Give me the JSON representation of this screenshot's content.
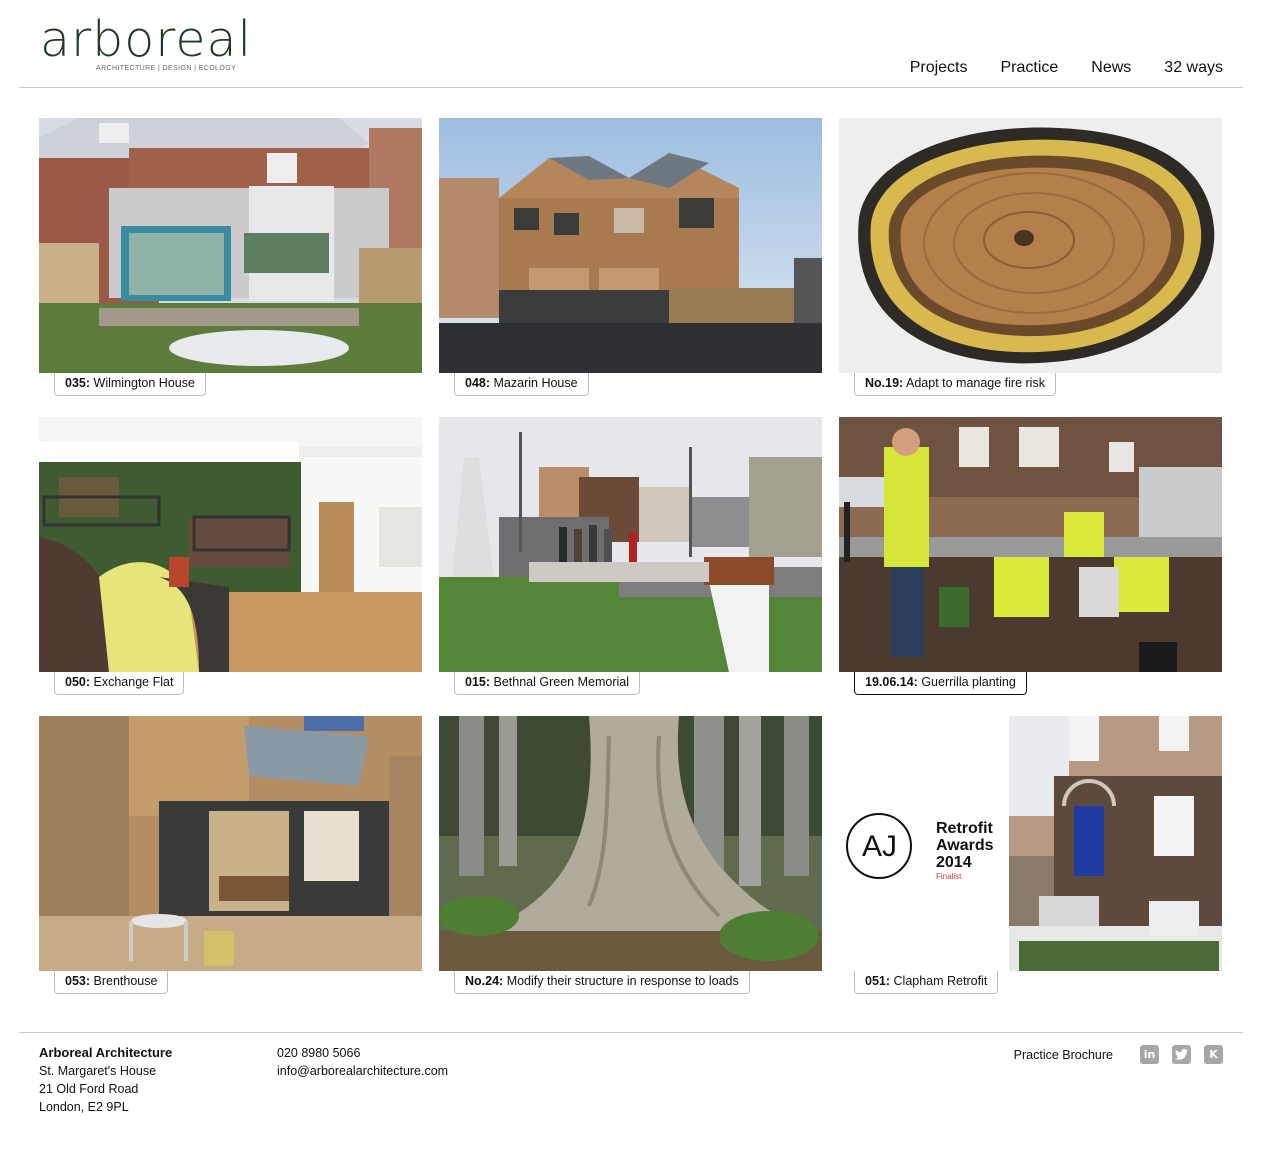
{
  "header": {
    "logo_text": "arboreal",
    "logo_tagline": "ARCHITECTURE | DESIGN | ECOLOGY",
    "nav": [
      "Projects",
      "Practice",
      "News",
      "32 ways"
    ]
  },
  "projects": [
    {
      "num": "035:",
      "title": "Wilmington House"
    },
    {
      "num": "048:",
      "title": "Mazarin House"
    },
    {
      "num": "No.19:",
      "title": "Adapt to manage fire risk"
    },
    {
      "num": "050:",
      "title": "Exchange Flat"
    },
    {
      "num": "015:",
      "title": "Bethnal Green Memorial"
    },
    {
      "num": "19.06.14:",
      "title": "Guerrilla planting"
    },
    {
      "num": "053:",
      "title": "Brenthouse"
    },
    {
      "num": "No.24:",
      "title": "Modify their structure in response to loads"
    },
    {
      "num": "051:",
      "title": "Clapham Retrofit"
    }
  ],
  "award": {
    "logo": "AJ",
    "line1": "Retrofit",
    "line2": "Awards",
    "line3": "2014",
    "status": "Finalist"
  },
  "footer": {
    "company": "Arboreal Architecture",
    "address1": "St. Margaret's House",
    "address2": "21 Old Ford Road",
    "address3": "London, E2 9PL",
    "phone": "020 8980 5066",
    "email": "info@arborealarchitecture.com",
    "brochure": "Practice Brochure",
    "social": [
      "linkedin-icon",
      "twitter-icon",
      "k-icon"
    ]
  }
}
